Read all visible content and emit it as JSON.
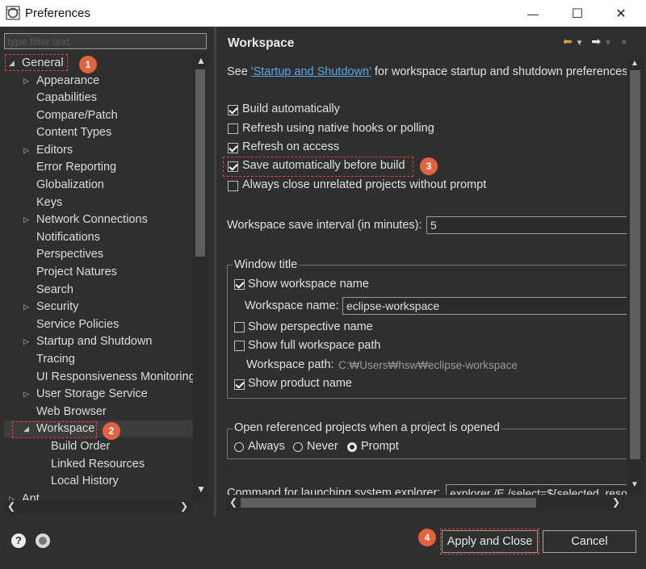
{
  "window": {
    "title": "Preferences",
    "minimize": "—",
    "maximize": "☐",
    "close": "✕"
  },
  "filter": {
    "placeholder": "type filter text"
  },
  "tree": {
    "items": [
      {
        "label": "General",
        "twisty": "◢"
      },
      {
        "label": "Appearance",
        "twisty": "▷"
      },
      {
        "label": "Capabilities",
        "twisty": ""
      },
      {
        "label": "Compare/Patch",
        "twisty": ""
      },
      {
        "label": "Content Types",
        "twisty": ""
      },
      {
        "label": "Editors",
        "twisty": "▷"
      },
      {
        "label": "Error Reporting",
        "twisty": ""
      },
      {
        "label": "Globalization",
        "twisty": ""
      },
      {
        "label": "Keys",
        "twisty": ""
      },
      {
        "label": "Network Connections",
        "twisty": "▷"
      },
      {
        "label": "Notifications",
        "twisty": ""
      },
      {
        "label": "Perspectives",
        "twisty": ""
      },
      {
        "label": "Project Natures",
        "twisty": ""
      },
      {
        "label": "Search",
        "twisty": ""
      },
      {
        "label": "Security",
        "twisty": "▷"
      },
      {
        "label": "Service Policies",
        "twisty": ""
      },
      {
        "label": "Startup and Shutdown",
        "twisty": "▷"
      },
      {
        "label": "Tracing",
        "twisty": ""
      },
      {
        "label": "UI Responsiveness Monitoring",
        "twisty": ""
      },
      {
        "label": "User Storage Service",
        "twisty": "▷"
      },
      {
        "label": "Web Browser",
        "twisty": ""
      },
      {
        "label": "Workspace",
        "twisty": "◢"
      },
      {
        "label": "Build Order",
        "twisty": ""
      },
      {
        "label": "Linked Resources",
        "twisty": ""
      },
      {
        "label": "Local History",
        "twisty": ""
      },
      {
        "label": "Ant",
        "twisty": "▷"
      }
    ]
  },
  "panel": {
    "title": "Workspace",
    "intro_prefix": "See ",
    "intro_link": "'Startup and Shutdown'",
    "intro_suffix": " for workspace startup and shutdown preferences",
    "build_auto": {
      "label": "Build automatically",
      "checked": true
    },
    "refresh_native": {
      "label": "Refresh using native hooks or polling",
      "checked": false
    },
    "refresh_access": {
      "label": "Refresh on access",
      "checked": true
    },
    "save_before_build": {
      "label": "Save automatically before build",
      "checked": true
    },
    "always_close": {
      "label": "Always close unrelated projects without prompt",
      "checked": false
    },
    "save_interval_label": "Workspace save interval (in minutes):",
    "save_interval_value": "5",
    "window_title_group": "Window title",
    "show_ws_name": {
      "label": "Show workspace name",
      "checked": true
    },
    "ws_name_label": "Workspace name:",
    "ws_name_value": "eclipse-workspace",
    "show_perspective": {
      "label": "Show perspective name",
      "checked": false
    },
    "show_full_path": {
      "label": "Show full workspace path",
      "checked": false
    },
    "ws_path_label": "Workspace path:",
    "ws_path_value": "C:₩Users₩hsw₩eclipse-workspace",
    "show_product": {
      "label": "Show product name",
      "checked": true
    },
    "open_ref_group": "Open referenced projects when a project is opened",
    "radio_always": "Always",
    "radio_never": "Never",
    "radio_prompt": "Prompt",
    "radio_selected": "Prompt",
    "cmd_label": "Command for launching system explorer:",
    "cmd_value": "explorer /E,/select=${selected_resource_loc}"
  },
  "buttons": {
    "apply_close": "Apply and Close",
    "cancel": "Cancel",
    "help": "?"
  },
  "badges": [
    "1",
    "2",
    "3",
    "4"
  ],
  "colors": {
    "background": "#2f2f2f",
    "text": "#e0e0e0",
    "link": "#57a7e6",
    "badge": "#e2643f",
    "highlight_box": "#e3413d"
  }
}
